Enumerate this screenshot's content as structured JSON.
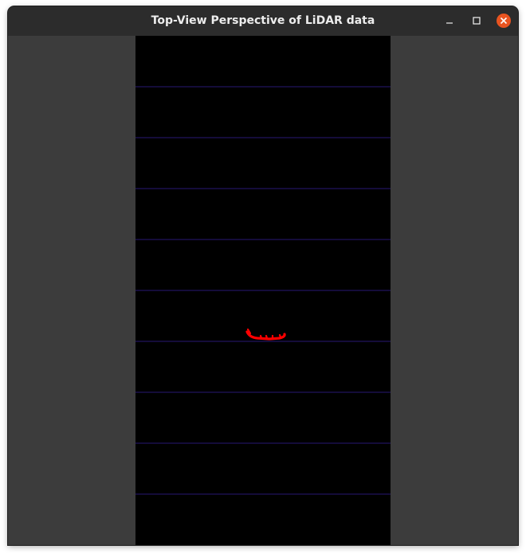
{
  "window": {
    "title": "Top-View Perspective of LiDAR data"
  },
  "controls": {
    "minimize_icon": "minimize-icon",
    "maximize_icon": "maximize-icon",
    "close_icon": "close-icon"
  },
  "colors": {
    "window_bg": "#3c3c3c",
    "titlebar_bg": "#2c2c2c",
    "lidar_bg": "#000000",
    "grid_line": "#140c3a",
    "point_cloud": "#ff0000",
    "close_button": "#e95420"
  },
  "lidar_view": {
    "grid_line_count": 9
  }
}
